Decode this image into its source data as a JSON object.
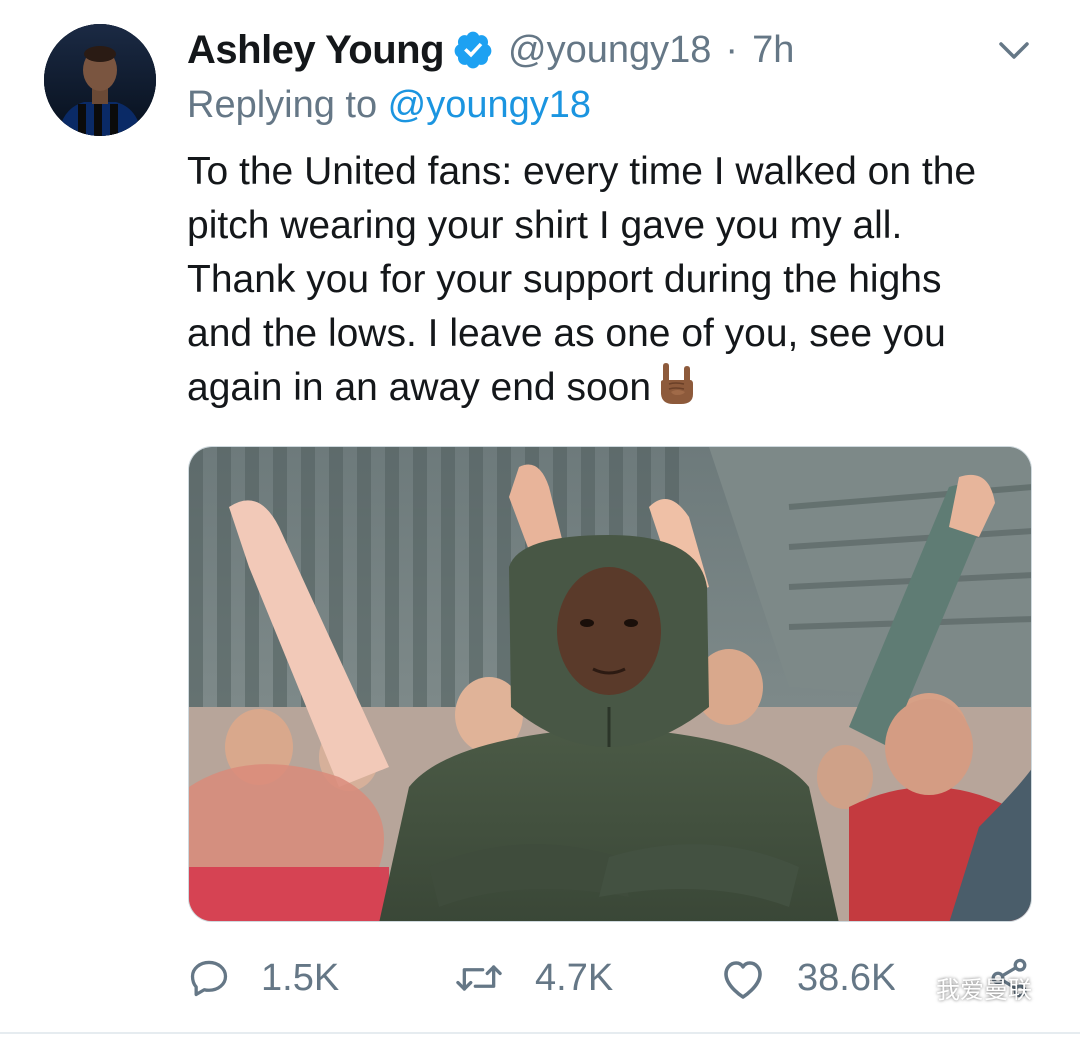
{
  "tweet": {
    "author": {
      "name": "Ashley Young",
      "handle": "@youngy18",
      "separator": "·",
      "time": "7h"
    },
    "replying": {
      "prefix": "Replying to ",
      "mention": "@youngy18"
    },
    "text": "To the United fans: every time I walked on the pitch wearing your shirt I gave you my all. Thank you for your support during the highs and the lows. I leave as one of you, see you again in an away end soon",
    "emoji": "🤘🏾",
    "actions": {
      "reply_count": "1.5K",
      "retweet_count": "4.7K",
      "like_count": "38.6K"
    }
  },
  "watermark": {
    "text": "我爱曼联"
  },
  "colors": {
    "text": "#14171a",
    "secondary": "#657786",
    "link": "#1b95e0",
    "verified": "#1da1f2"
  },
  "icons": {
    "verified": "verified-badge-icon",
    "caret": "chevron-down-icon",
    "reply": "reply-icon",
    "retweet": "retweet-icon",
    "like": "heart-icon",
    "share": "share-icon"
  }
}
